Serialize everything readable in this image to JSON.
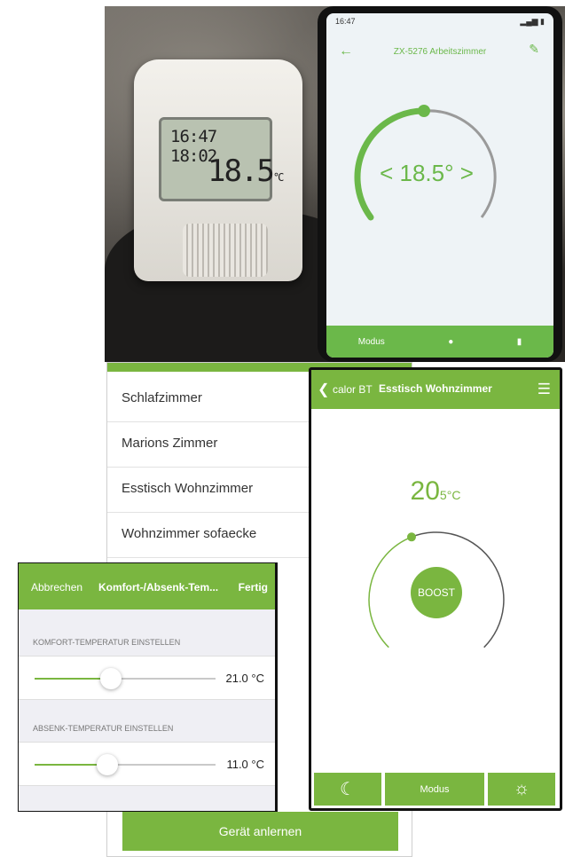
{
  "photo": {
    "thermostat_time": "16:47",
    "thermostat_time2": "18:02",
    "thermostat_temp": "18.5",
    "thermostat_unit": "°C",
    "phone_status_time": "16:47",
    "phone_title": "ZX-5276 Arbeitszimmer",
    "phone_temp": "< 18.5° >",
    "phone_nav_left": "Modus"
  },
  "device_list": {
    "items": [
      "Schlafzimmer",
      "Marions Zimmer",
      "Esstisch Wohnzimmer",
      "Wohnzimmer sofaecke"
    ],
    "learn_button": "Gerät anlernen"
  },
  "calor": {
    "app_name": "calor BT",
    "room": "Esstisch Wohnzimmer",
    "temp_main": "20",
    "temp_decimal": "5",
    "temp_unit": "°C",
    "boost_label": "BOOST",
    "mode_label": "Modus",
    "accent": "#7ab640",
    "setpoint_fraction": 0.42
  },
  "komfort": {
    "cancel": "Abbrechen",
    "title": "Komfort-/Absenk-Tem...",
    "done": "Fertig",
    "comfort_label": "KOMFORT-TEMPERATUR EINSTELLEN",
    "comfort_value": "21.0 °C",
    "comfort_fraction": 0.42,
    "eco_label": "ABSENK-TEMPERATUR EINSTELLEN",
    "eco_value": "11.0 °C",
    "eco_fraction": 0.4
  }
}
